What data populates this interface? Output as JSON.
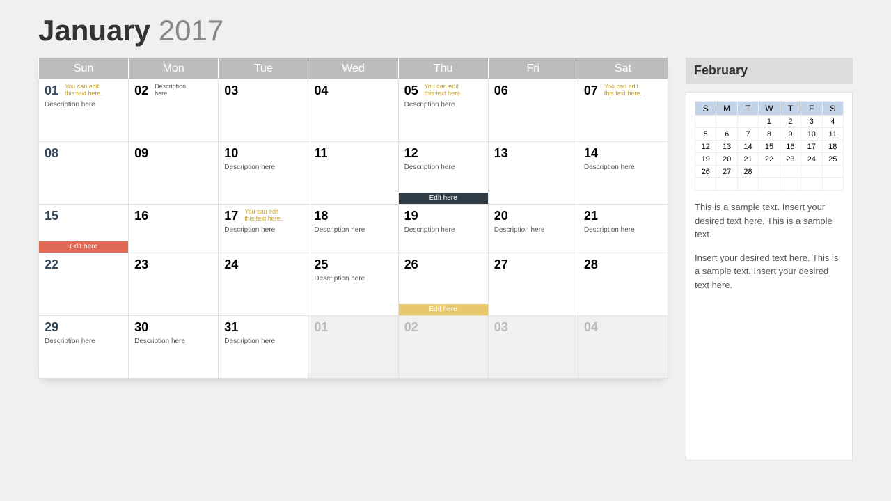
{
  "title": {
    "month": "January",
    "year": "2017"
  },
  "headers": [
    "Sun",
    "Mon",
    "Tue",
    "Wed",
    "Thu",
    "Fri",
    "Sat"
  ],
  "hint_text": "You can edit this text here.",
  "desc_text": "Description here",
  "bar_text": "Edit here",
  "weeks": [
    [
      {
        "n": "01",
        "sun": true,
        "hint": true,
        "desc": true
      },
      {
        "n": "02",
        "hint2": "Description here"
      },
      {
        "n": "03"
      },
      {
        "n": "04"
      },
      {
        "n": "05",
        "hint": true,
        "desc": true
      },
      {
        "n": "06"
      },
      {
        "n": "07",
        "hint": true
      }
    ],
    [
      {
        "n": "08",
        "sun": true
      },
      {
        "n": "09"
      },
      {
        "n": "10",
        "desc": true
      },
      {
        "n": "11"
      },
      {
        "n": "12",
        "desc": true,
        "bar": "dark"
      },
      {
        "n": "13"
      },
      {
        "n": "14",
        "desc": true
      }
    ],
    [
      {
        "n": "15",
        "sun": true,
        "bar": "red"
      },
      {
        "n": "16"
      },
      {
        "n": "17",
        "hint": true,
        "desc": true
      },
      {
        "n": "18",
        "desc": true
      },
      {
        "n": "19",
        "desc": true
      },
      {
        "n": "20",
        "desc": true
      },
      {
        "n": "21",
        "desc": true
      }
    ],
    [
      {
        "n": "22",
        "sun": true
      },
      {
        "n": "23"
      },
      {
        "n": "24"
      },
      {
        "n": "25",
        "desc": true
      },
      {
        "n": "26",
        "bar": "yellow"
      },
      {
        "n": "27"
      },
      {
        "n": "28"
      }
    ],
    [
      {
        "n": "29",
        "sun": true,
        "desc": true
      },
      {
        "n": "30",
        "desc": true
      },
      {
        "n": "31",
        "desc": true
      },
      {
        "n": "01",
        "out": true
      },
      {
        "n": "02",
        "out": true
      },
      {
        "n": "03",
        "out": true
      },
      {
        "n": "04",
        "out": true
      }
    ]
  ],
  "side": {
    "title": "February",
    "mini_headers": [
      "S",
      "M",
      "T",
      "W",
      "T",
      "F",
      "S"
    ],
    "mini_rows": [
      [
        "",
        "",
        "",
        "1",
        "2",
        "3",
        "4"
      ],
      [
        "5",
        "6",
        "7",
        "8",
        "9",
        "10",
        "11"
      ],
      [
        "12",
        "13",
        "14",
        "15",
        "16",
        "17",
        "18"
      ],
      [
        "19",
        "20",
        "21",
        "22",
        "23",
        "24",
        "25"
      ],
      [
        "26",
        "27",
        "28",
        "",
        "",
        "",
        ""
      ],
      [
        "",
        "",
        "",
        "",
        "",
        "",
        ""
      ]
    ],
    "para1": "This is a sample text. Insert your desired text here. This is a sample text.",
    "para2": "Insert your desired text here. This is a sample text. Insert your desired text here."
  }
}
